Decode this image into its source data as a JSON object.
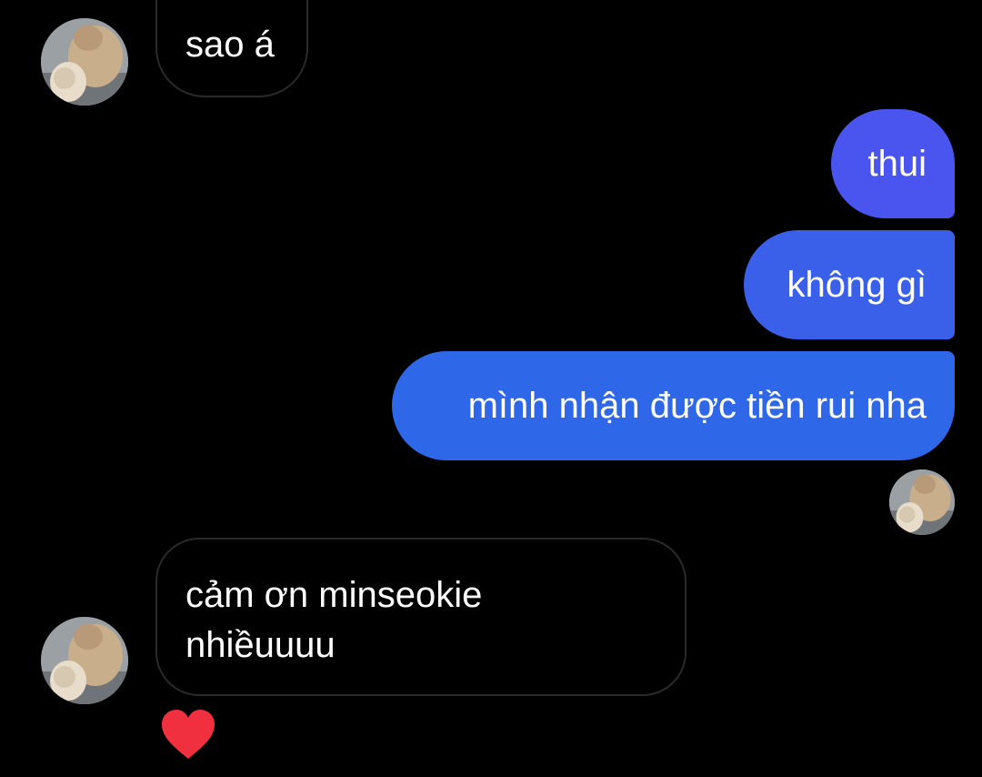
{
  "thread": {
    "messages": [
      {
        "sender": "them",
        "text": "sao á"
      },
      {
        "sender": "me",
        "text": "thui"
      },
      {
        "sender": "me",
        "text": "không gì"
      },
      {
        "sender": "me",
        "text": "mình nhận được tiền rui nha"
      },
      {
        "sender": "them",
        "text": "cảm ơn minseokie nhiềuuuu",
        "reaction": "heart"
      }
    ]
  },
  "colors": {
    "background": "#000000",
    "incoming_border": "#2a2a2c",
    "outgoing_top": "#4a55ef",
    "outgoing_mid": "#3a60ea",
    "outgoing_bottom": "#2e67e8",
    "reaction_heart": "#f0303f"
  },
  "icons": {
    "avatar": "avatar-photo",
    "reaction": "heart-icon"
  }
}
